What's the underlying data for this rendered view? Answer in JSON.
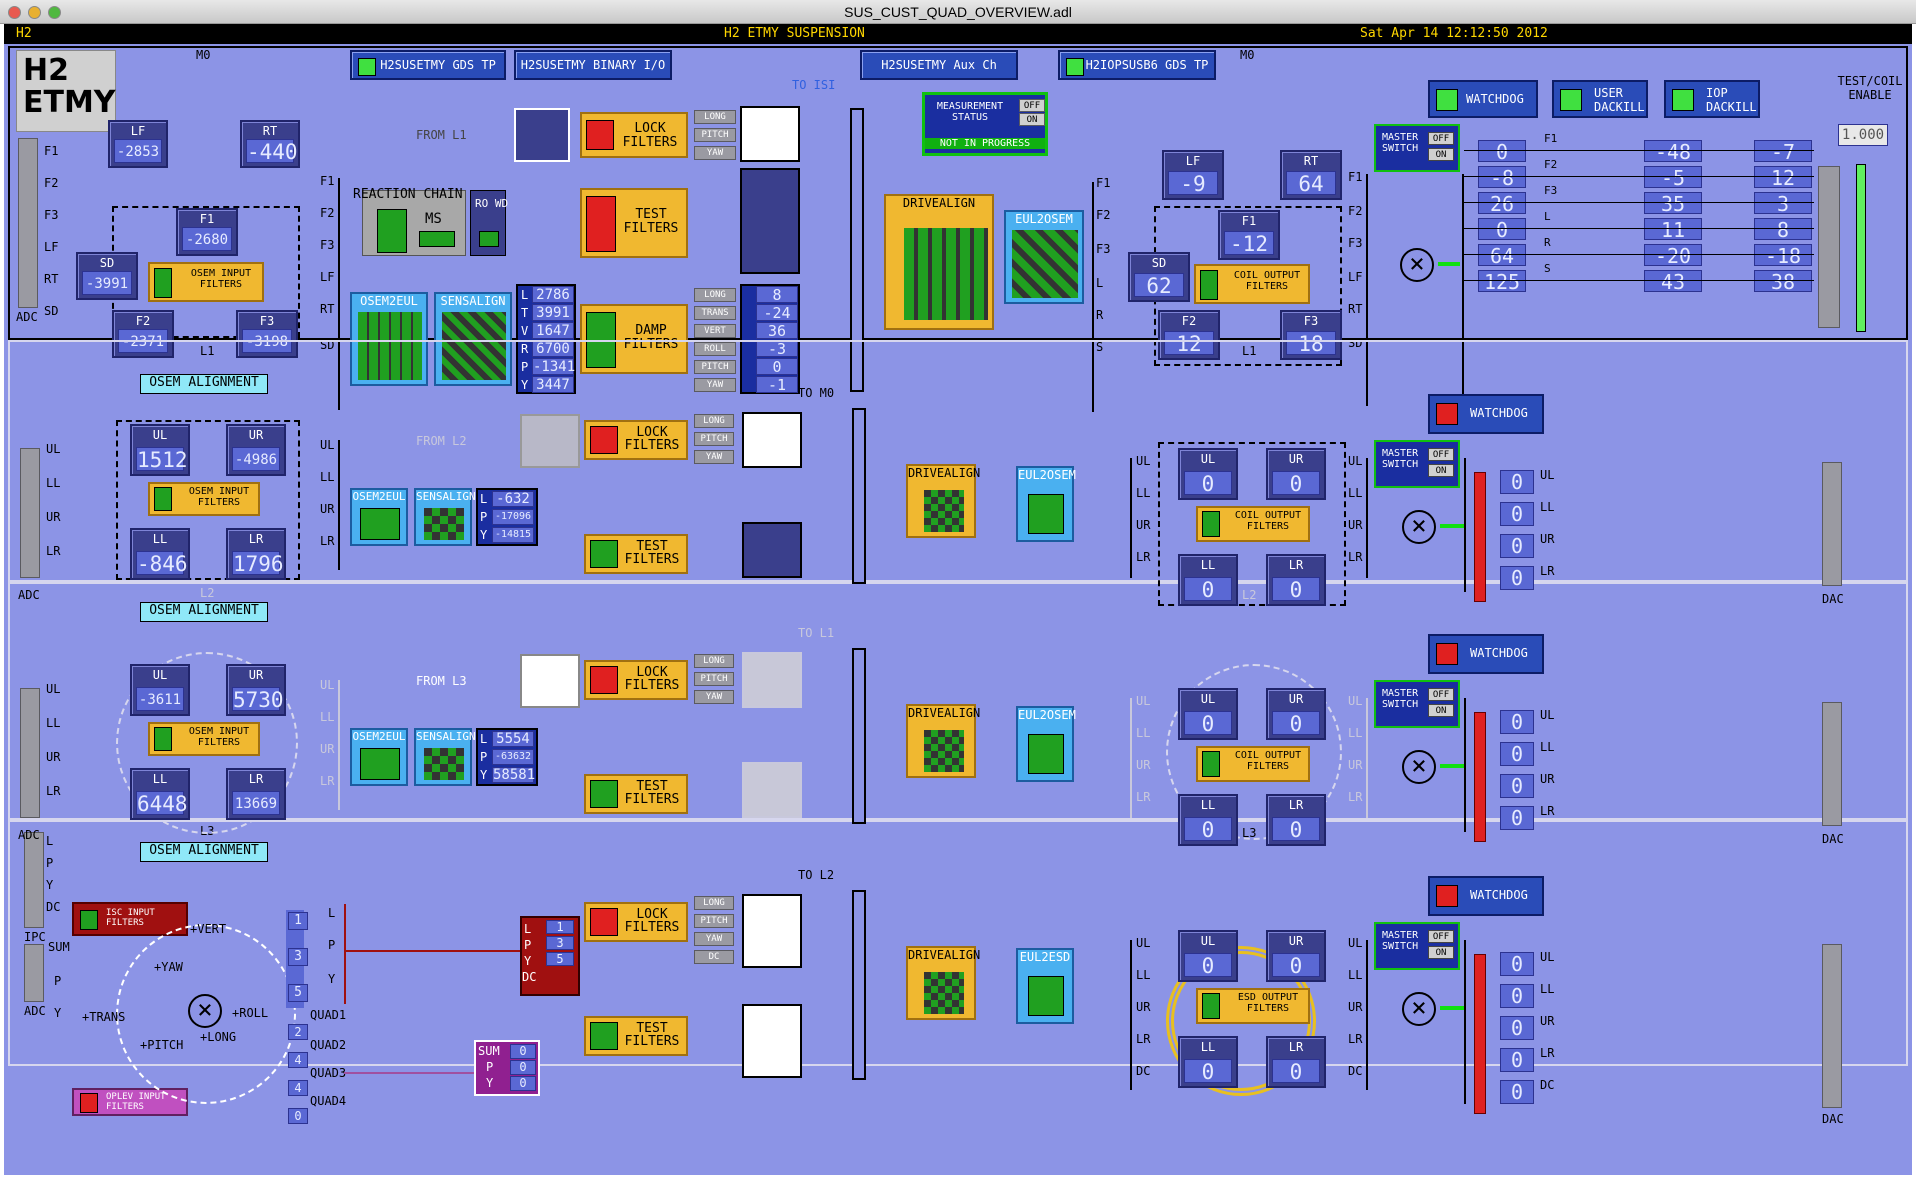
{
  "window": {
    "title": "SUS_CUST_QUAD_OVERVIEW.adl"
  },
  "banner": {
    "left": "H2",
    "center": "H2 ETMY SUSPENSION",
    "right": "Sat Apr 14 12:12:50 2012"
  },
  "header": {
    "logo_l1": "H2",
    "logo_l2": "ETMY"
  },
  "top_buttons": {
    "gds_tp": "H2SUSETMY GDS TP",
    "binary_io": "H2SUSETMY BINARY I/O",
    "aux_ch": "H2SUSETMY Aux Ch",
    "iop_gds": "H2IOPSUSB6 GDS TP"
  },
  "common": {
    "lock_filters": "LOCK FILTERS",
    "test_filters": "TEST FILTERS",
    "damp_filters": "DAMP FILTERS",
    "osem_input": "OSEM INPUT FILTERS",
    "coil_output": "COIL OUTPUT FILTERS",
    "osem2eul": "OSEM2EUL",
    "sensalign": "SENSALIGN",
    "drivealign": "DRIVEALIGN",
    "eul2osem": "EUL2OSEM",
    "eul2esd": "EUL2ESD",
    "osem_alignment": "OSEM ALIGNMENT",
    "watchdog": "WATCHDOG",
    "master": "MASTER SWITCH",
    "off": "OFF",
    "on": "ON",
    "adc": "ADC",
    "dac": "DAC",
    "ipc": "IPC",
    "long": "LONG",
    "pitch": "PITCH",
    "yaw": "YAW",
    "trans": "TRANS",
    "vert": "VERT",
    "roll": "ROLL",
    "dc": "DC"
  },
  "m0": {
    "label": "M0",
    "from_l1": "FROM L1",
    "to_isi": "TO ISI",
    "reaction_chain": "REACTION CHAIN",
    "ms": "MS",
    "ro_wd": "RO WD",
    "osem": {
      "LF": "-2853",
      "RT": "-440",
      "F1": "-2680",
      "SD": "-3991",
      "F2": "-2371",
      "F3": "-3198"
    },
    "ltv": [
      "2786",
      "3991",
      "1647",
      "6700",
      "-1341",
      "3447"
    ],
    "damp_out": [
      "8",
      "-24",
      "36",
      "-3",
      "0",
      "-1"
    ],
    "measurement": "MEASUREMENT STATUS",
    "not_in_progress": "NOT IN PROGRESS",
    "coil": {
      "LF": "-9",
      "RT": "64",
      "F1": "-12",
      "SD": "62",
      "F2": "12",
      "F3": "18"
    },
    "user_dackill": "USER DACKILL",
    "iop_dackill": "IOP DACKILL",
    "test_coil": "TEST/COIL ENABLE",
    "test_coil_val": "1.000",
    "out_labels": [
      "F1",
      "F2",
      "F3",
      "L",
      "R",
      "S"
    ],
    "col1": [
      "0",
      "-8",
      "26",
      "0",
      "64",
      "125"
    ],
    "col2": [
      "-48",
      "-5",
      "35",
      "11",
      "-20",
      "43"
    ],
    "col3": [
      "-7",
      "12",
      "3",
      "8",
      "-18",
      "38"
    ]
  },
  "l1": {
    "label": "L1",
    "from_l2": "FROM L2",
    "to_m0": "TO M0",
    "osem": {
      "UL": "1512",
      "UR": "-4986",
      "LL": "-846",
      "LR": "1796"
    },
    "lpy": [
      "-632",
      "-17096",
      "-14815"
    ],
    "out": [
      "0",
      "0",
      "0",
      "0"
    ]
  },
  "l2": {
    "label": "L2",
    "from_l3": "FROM L3",
    "to_l1": "TO L1",
    "osem": {
      "UL": "-3611",
      "UR": "5730",
      "LL": "6448",
      "LR": "13669"
    },
    "lpy": [
      "5554",
      "-63632",
      "58581"
    ],
    "out": [
      "0",
      "0",
      "0",
      "0"
    ]
  },
  "l3": {
    "label": "L3",
    "to_l2": "TO L2",
    "isc": "ISC INPUT FILTERS",
    "oplev": "OPLEV INPUT FILTERS",
    "esd_output": "ESD OUTPUT FILTERS",
    "lpy_in": [
      "1",
      "3",
      "5"
    ],
    "lpy_dc": [
      "1",
      "3",
      "5"
    ],
    "quads": [
      "2",
      "4",
      "4",
      "0"
    ],
    "quad_labels": [
      "QUAD1",
      "QUAD2",
      "QUAD3",
      "QUAD4"
    ],
    "sum_vals": [
      "0",
      "0",
      "0"
    ],
    "out": [
      "0",
      "0",
      "0",
      "0",
      "0"
    ],
    "dofs": [
      "+VERT",
      "+YAW",
      "+TRANS",
      "+ROLL",
      "+PITCH",
      "+LONG"
    ],
    "in_labels": [
      "L",
      "P",
      "Y",
      "DC"
    ],
    "sum_labels": [
      "SUM",
      "P",
      "Y"
    ]
  }
}
